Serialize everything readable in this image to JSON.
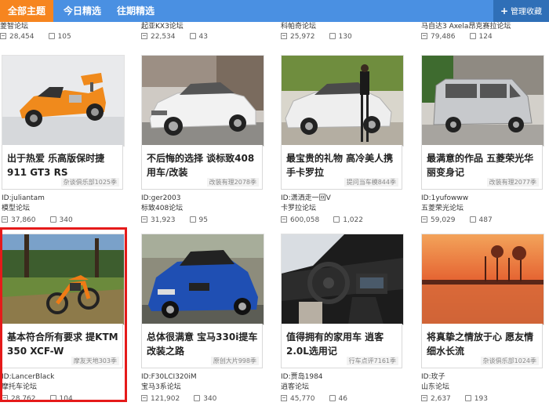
{
  "nav": {
    "tabs": [
      {
        "label": "全部主题",
        "active": true
      },
      {
        "label": "今日精选",
        "active": false
      },
      {
        "label": "往期精选",
        "active": false
      }
    ],
    "favorite_label": "管理收藏"
  },
  "previous_row": [
    {
      "forum": "菱智论坛",
      "views": "28,454",
      "comments": "105"
    },
    {
      "forum": "起亚KX3论坛",
      "views": "22,534",
      "comments": "43"
    },
    {
      "forum": "科帕奇论坛",
      "views": "25,972",
      "comments": "130"
    },
    {
      "forum": "马自达3 Axela昂克赛拉论坛",
      "views": "79,486",
      "comments": "124"
    }
  ],
  "cards": [
    {
      "title": "出于热爱 乐高版保时捷911 GT3 RS",
      "tag": "杂谈俱乐部1025季",
      "author": "ID:juliantam",
      "forum": "模型论坛",
      "views": "37,860",
      "comments": "340",
      "image": "lego-porsche-icon"
    },
    {
      "title": "不后悔的选择 谈标致408用车/改装",
      "tag": "改装有理2078季",
      "author": "ID:ger2003",
      "forum": "标致408论坛",
      "views": "31,923",
      "comments": "95",
      "image": "peugeot-sedan-icon"
    },
    {
      "title": "最宝贵的礼物 高冷美人携手卡罗拉",
      "tag": "提问当车模844季",
      "author": "ID:潇洒走一回V",
      "forum": "卡罗拉论坛",
      "views": "600,058",
      "comments": "1,022",
      "image": "corolla-model-icon"
    },
    {
      "title": "最满意的作品 五菱荣光华丽变身记",
      "tag": "改装有理2077季",
      "author": "ID:1yufowww",
      "forum": "五菱荣光论坛",
      "views": "59,029",
      "comments": "487",
      "image": "wuling-van-icon"
    },
    {
      "title": "基本符合所有要求 提KTM 350 XCF-W",
      "tag": "摩友天地303季",
      "author": "ID:LancerBlack",
      "forum": "摩托车论坛",
      "views": "28,762",
      "comments": "104",
      "image": "ktm-motorcycle-icon"
    },
    {
      "title": "总体很满意 宝马330i提车改装之路",
      "tag": "原创大片998季",
      "author": "ID:F30LCI320iM",
      "forum": "宝马3系论坛",
      "views": "121,902",
      "comments": "340",
      "image": "bmw-sedan-icon"
    },
    {
      "title": "值得拥有的家用车 逍客2.0L选用记",
      "tag": "行车点评7161季",
      "author": "ID:贾岛1984",
      "forum": "逍客论坛",
      "views": "45,770",
      "comments": "46",
      "image": "car-interior-icon"
    },
    {
      "title": "将真挚之情放于心 愿友情细水长流",
      "tag": "杂谈俱乐部1024季",
      "author": "ID:玫子",
      "forum": "山东论坛",
      "views": "2,637",
      "comments": "193",
      "image": "sunset-lake-icon"
    }
  ],
  "colors": {
    "topbar": "#4a90e2",
    "active_tab": "#f6851f",
    "favorite": "#2f6fb7",
    "highlight": "#e51a1a"
  }
}
